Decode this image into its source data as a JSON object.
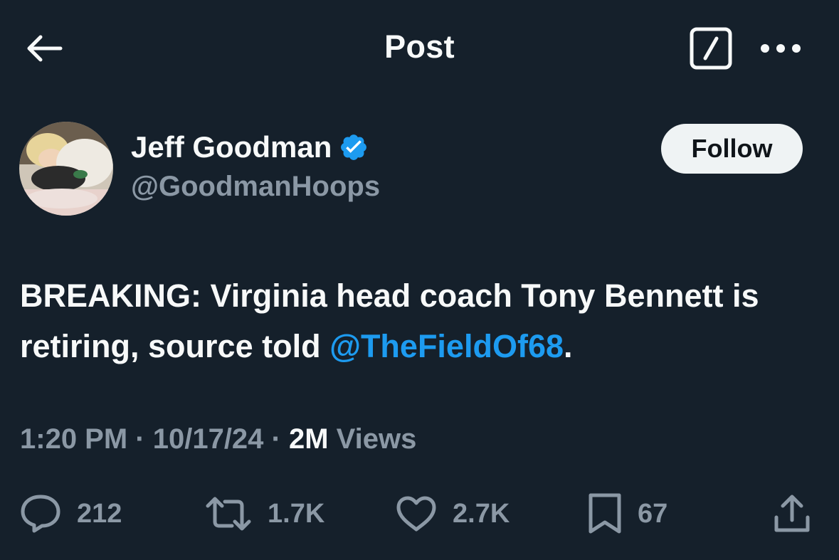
{
  "header": {
    "title": "Post"
  },
  "author": {
    "name": "Jeff Goodman",
    "handle": "@GoodmanHoops",
    "verified": true,
    "follow_label": "Follow"
  },
  "tweet": {
    "text_before": "BREAKING: Virginia head coach Tony Bennett is retiring, source told ",
    "mention": "@TheFieldOf68",
    "text_after": "."
  },
  "meta": {
    "time": "1:20 PM",
    "separator": " · ",
    "date": "10/17/24",
    "views_count": "2M",
    "views_label": " Views"
  },
  "actions": {
    "replies": "212",
    "reposts": "1.7K",
    "likes": "2.7K",
    "bookmarks": "67"
  },
  "colors": {
    "background": "#15202b",
    "text_primary": "#f7f9f9",
    "text_secondary": "#8b98a5",
    "accent": "#1d9bf0",
    "follow_button_bg": "#eff3f4"
  },
  "icons": {
    "back": "arrow-left-icon",
    "edit": "grok-slash-icon",
    "more": "more-horizontal-icon",
    "verified": "verified-badge-icon",
    "reply": "speech-bubble-icon",
    "repost": "repost-icon",
    "like": "heart-icon",
    "bookmark": "bookmark-icon",
    "share": "share-upload-icon"
  }
}
